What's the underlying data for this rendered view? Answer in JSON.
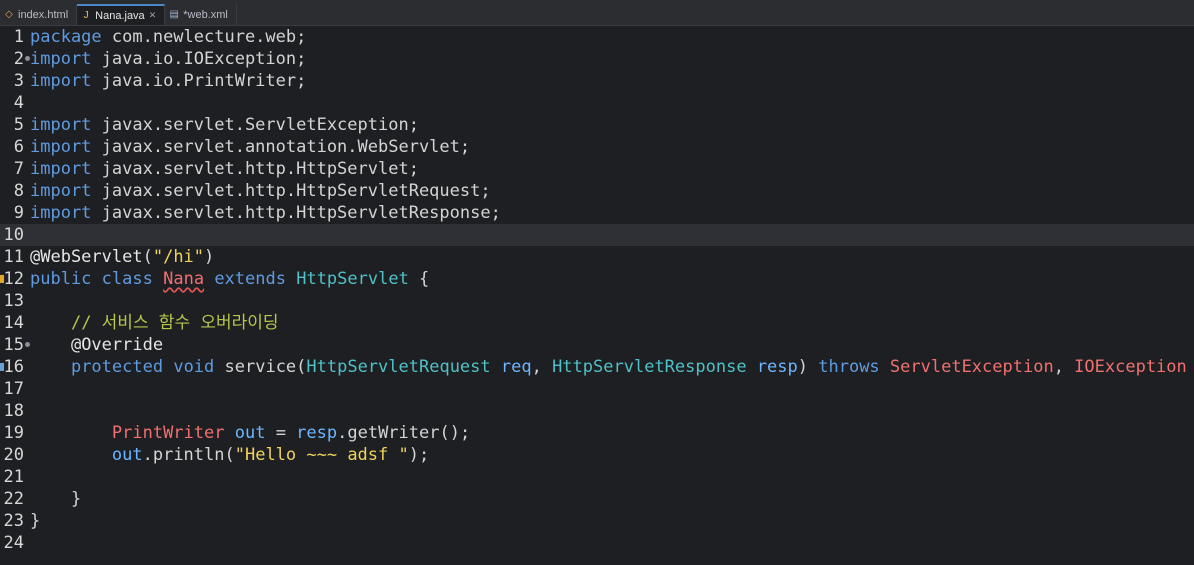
{
  "tabs": [
    {
      "label": "index.html",
      "icon": "html-file-icon",
      "active": false
    },
    {
      "label": "Nana.java",
      "icon": "java-file-icon",
      "active": true,
      "close": "✕"
    },
    {
      "label": "*web.xml",
      "icon": "xml-file-icon",
      "active": false
    }
  ],
  "lines": [
    {
      "n": "1",
      "tokens": [
        [
          "kw",
          "package"
        ],
        [
          "plain",
          " com.newlecture.web;"
        ]
      ]
    },
    {
      "n": "2",
      "tokens": [
        [
          "kw",
          "import"
        ],
        [
          "plain",
          " java.io.IOException;"
        ]
      ],
      "fold": true
    },
    {
      "n": "3",
      "tokens": [
        [
          "kw",
          "import"
        ],
        [
          "plain",
          " java.io.PrintWriter;"
        ]
      ]
    },
    {
      "n": "4",
      "tokens": []
    },
    {
      "n": "5",
      "tokens": [
        [
          "kw",
          "import"
        ],
        [
          "plain",
          " javax.servlet.ServletException;"
        ]
      ]
    },
    {
      "n": "6",
      "tokens": [
        [
          "kw",
          "import"
        ],
        [
          "plain",
          " javax.servlet.annotation.WebServlet;"
        ]
      ]
    },
    {
      "n": "7",
      "tokens": [
        [
          "kw",
          "import"
        ],
        [
          "plain",
          " javax.servlet.http.HttpServlet;"
        ]
      ]
    },
    {
      "n": "8",
      "tokens": [
        [
          "kw",
          "import"
        ],
        [
          "plain",
          " javax.servlet.http.HttpServletRequest;"
        ]
      ]
    },
    {
      "n": "9",
      "tokens": [
        [
          "kw",
          "import"
        ],
        [
          "plain",
          " javax.servlet.http.HttpServletResponse;"
        ]
      ]
    },
    {
      "n": "10",
      "tokens": [],
      "current": true
    },
    {
      "n": "11",
      "tokens": [
        [
          "ann",
          "@WebServlet"
        ],
        [
          "plain",
          "("
        ],
        [
          "str",
          "\"/hi\""
        ],
        [
          "plain",
          ")"
        ]
      ]
    },
    {
      "n": "12",
      "tokens": [
        [
          "kw",
          "public"
        ],
        [
          "plain",
          " "
        ],
        [
          "kw",
          "class"
        ],
        [
          "plain",
          " "
        ],
        [
          "err-under",
          "Nana"
        ],
        [
          "plain",
          " "
        ],
        [
          "kw",
          "extends"
        ],
        [
          "plain",
          " "
        ],
        [
          "cls",
          "HttpServlet"
        ],
        [
          "plain",
          " {"
        ]
      ],
      "marker": "orange"
    },
    {
      "n": "13",
      "tokens": []
    },
    {
      "n": "14",
      "tokens": [
        [
          "plain",
          "    "
        ],
        [
          "cmt",
          "// 서비스 함수 오버라이딩"
        ]
      ]
    },
    {
      "n": "15",
      "tokens": [
        [
          "plain",
          "    "
        ],
        [
          "ann",
          "@Override"
        ]
      ],
      "fold": true
    },
    {
      "n": "16",
      "tokens": [
        [
          "plain",
          "    "
        ],
        [
          "kw",
          "protected"
        ],
        [
          "plain",
          " "
        ],
        [
          "kw",
          "void"
        ],
        [
          "plain",
          " service("
        ],
        [
          "cls",
          "HttpServletRequest"
        ],
        [
          "plain",
          " "
        ],
        [
          "var",
          "req"
        ],
        [
          "plain",
          ", "
        ],
        [
          "cls",
          "HttpServletResponse"
        ],
        [
          "plain",
          " "
        ],
        [
          "var",
          "resp"
        ],
        [
          "plain",
          ") "
        ],
        [
          "kw",
          "throws"
        ],
        [
          "plain",
          " "
        ],
        [
          "err",
          "ServletException"
        ],
        [
          "plain",
          ", "
        ],
        [
          "err",
          "IOException"
        ],
        [
          "plain",
          " {"
        ]
      ],
      "marker": "blue"
    },
    {
      "n": "17",
      "tokens": []
    },
    {
      "n": "18",
      "tokens": []
    },
    {
      "n": "19",
      "tokens": [
        [
          "plain",
          "        "
        ],
        [
          "err",
          "PrintWriter"
        ],
        [
          "plain",
          " "
        ],
        [
          "var",
          "out"
        ],
        [
          "plain",
          " = "
        ],
        [
          "var",
          "resp"
        ],
        [
          "plain",
          ".getWriter();"
        ]
      ]
    },
    {
      "n": "20",
      "tokens": [
        [
          "plain",
          "        "
        ],
        [
          "var",
          "out"
        ],
        [
          "plain",
          ".println("
        ],
        [
          "str",
          "\"Hello ~~~ adsf \""
        ],
        [
          "plain",
          ");"
        ]
      ]
    },
    {
      "n": "21",
      "tokens": []
    },
    {
      "n": "22",
      "tokens": [
        [
          "plain",
          "    }"
        ]
      ]
    },
    {
      "n": "23",
      "tokens": [
        [
          "plain",
          "}"
        ]
      ]
    },
    {
      "n": "24",
      "tokens": []
    }
  ]
}
